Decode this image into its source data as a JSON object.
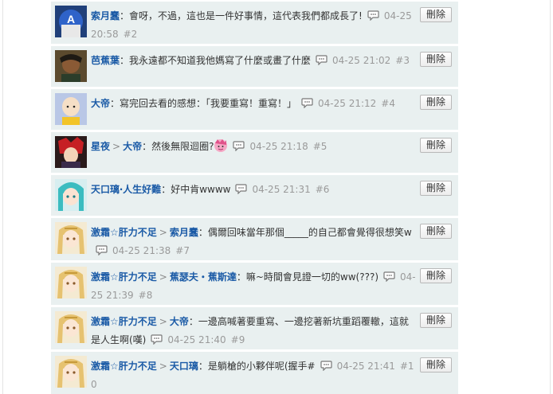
{
  "delete_label": "刪除",
  "replies": [
    {
      "avatar": "masked-hero-avatar",
      "user": "索月蠢",
      "reply_to": "",
      "message": "：會呀，不過，這也是一件好事情，這代表我們都成長了!",
      "time": "04-25 20:58",
      "floor": "#2"
    },
    {
      "avatar": "dark-warrior-avatar",
      "user": "芭蕉葉",
      "reply_to": "",
      "message": "：我永遠都不知道我他媽寫了什麼或畫了什麼",
      "time": "04-25 21:02",
      "floor": "#3"
    },
    {
      "avatar": "bald-hero-avatar",
      "user": "大帝",
      "reply_to": "",
      "message": "：寫完回去看的感想：「我要重寫！重寫！」",
      "time": "04-25 21:12",
      "floor": "#4"
    },
    {
      "avatar": "red-hair-avatar",
      "user": "星夜",
      "reply_to": "大帝",
      "message": "：然後無限迴圈?",
      "time": "04-25 21:18",
      "floor": "#5",
      "emoji": "pink-face-emoji"
    },
    {
      "avatar": "teal-hair-avatar",
      "user": "天口璃‧人生好難",
      "reply_to": "",
      "message": "：好中肯wwww",
      "time": "04-25 21:31",
      "floor": "#6"
    },
    {
      "avatar": "blonde-girl-avatar",
      "user": "激霜☆肝力不足",
      "reply_to": "索月蠢",
      "message": "：偶爾回味當年那個_____的自己都會覺得很想笑w",
      "time": "04-25 21:38",
      "floor": "#7"
    },
    {
      "avatar": "blonde-girl-avatar",
      "user": "激霜☆肝力不足",
      "reply_to": "蕉瑟夫・蕉斯達",
      "message": "：嘛~時間會見證一切的ww(???)",
      "time": "04-25 21:39",
      "floor": "#8"
    },
    {
      "avatar": "blonde-girl-avatar",
      "user": "激霜☆肝力不足",
      "reply_to": "大帝",
      "message": "：一邊高喊著要重寫、一邊挖著新坑重蹈覆轍，這就是人生啊(嘆)",
      "time": "04-25 21:40",
      "floor": "#9"
    },
    {
      "avatar": "blonde-girl-avatar",
      "user": "激霜☆肝力不足",
      "reply_to": "天口璃",
      "message": "：是躺槍的小夥伴呢(握手#",
      "time": "04-25 21:41",
      "floor": "#10"
    }
  ]
}
